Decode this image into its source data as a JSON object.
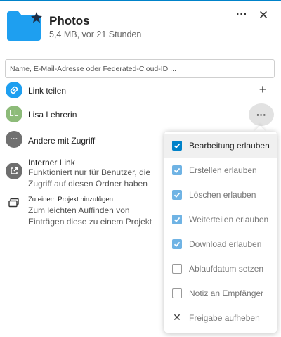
{
  "header": {
    "title": "Photos",
    "subtitle": "5,4 MB, vor 21 Stunden",
    "more_label": "···",
    "close_label": "✕"
  },
  "share_input": {
    "placeholder": "Name, E-Mail-Adresse oder Federated-Cloud-ID ...",
    "value": ""
  },
  "rows": {
    "share_link": {
      "label": "Link teilen",
      "action": "+"
    },
    "user": {
      "initials": "LL",
      "name": "Lisa Lehrerin",
      "more": "···"
    },
    "others": {
      "icon": "···",
      "label": "Andere mit Zugriff"
    },
    "internal_link": {
      "label": "Interner Link",
      "description": "Funktioniert nur für Benutzer, die Zugriff auf diesen Ordner haben"
    },
    "project": {
      "label": "Zu einem Projekt hinzufügen",
      "description": "Zum leichten Auffinden von Einträgen diese zu einem Projekt hinzufügen"
    }
  },
  "menu": {
    "items": [
      {
        "label": "Bearbeitung erlauben",
        "checked": true
      },
      {
        "label": "Erstellen erlauben",
        "checked": true
      },
      {
        "label": "Löschen erlauben",
        "checked": true
      },
      {
        "label": "Weiterteilen erlauben",
        "checked": true
      },
      {
        "label": "Download erlauben",
        "checked": true
      },
      {
        "label": "Ablaufdatum setzen",
        "checked": false
      },
      {
        "label": "Notiz an Empfänger",
        "checked": false
      }
    ],
    "unshare_label": "Freigabe aufheben"
  },
  "colors": {
    "accent": "#0082c9",
    "link_icon": "#1e9ff0",
    "avatar": "#8dbb79",
    "folder": "#1e9ff0"
  },
  "icons": {
    "folder": "folder-icon",
    "favorite": "star-icon",
    "link": "link-icon",
    "external": "external-link-icon",
    "project": "project-icon",
    "unshare": "close-icon"
  }
}
